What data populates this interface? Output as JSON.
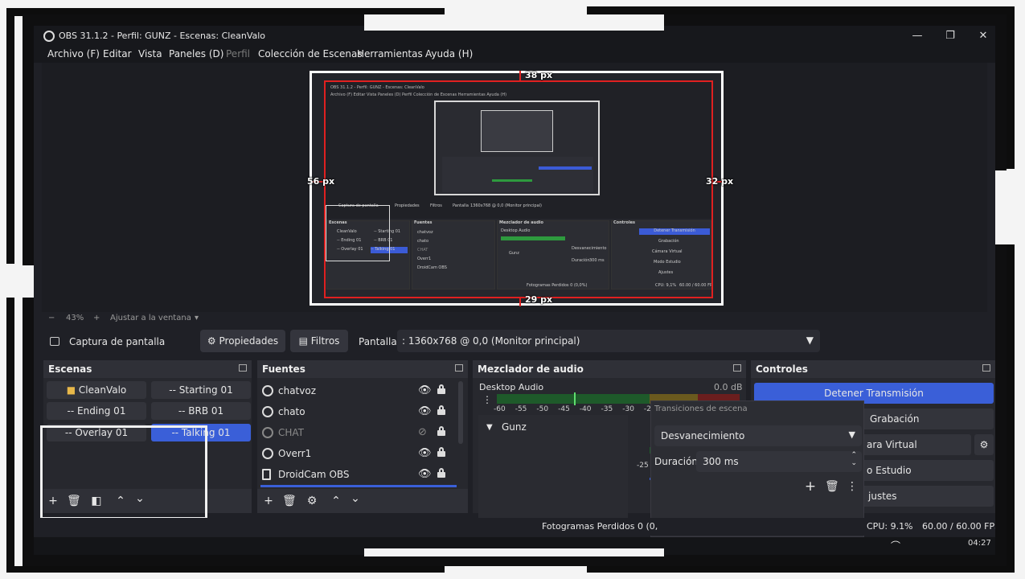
{
  "window": {
    "title": "OBS 31.1.2 - Perfil: GUNZ - Escenas: CleanValo",
    "minimize_icon": "minimize-icon",
    "maximize_icon": "restore-icon",
    "close_icon": "close-icon"
  },
  "menu": {
    "items": [
      "Archivo (F)",
      "Editar",
      "Vista",
      "Paneles (D)",
      "Perfil",
      "Colección de Escenas",
      "Herramientas",
      "Ayuda (H)"
    ]
  },
  "preview": {
    "label_top": "38 px",
    "label_left": "56 px",
    "label_right": "32 px",
    "label_bottom": "29 px",
    "mini_title": "OBS 31.1.2 - Perfil: GUNZ - Escenas: CleanValo",
    "mini_menu": "Archivo (F)   Editar   Vista   Paneles (D)   Perfil   Colección de Escenas   Herramientas   Ayuda (H)",
    "mini_source": "Captura de pantalla",
    "mini_props": "Propiedades",
    "mini_filters": "Filtros",
    "mini_screen": "Pantalla",
    "mini_monitor": "1360x768 @ 0,0 (Monitor principal)",
    "mini_scenes_title": "Escenas",
    "mini_sources_title": "Fuentes",
    "mini_mixer_title": "Mezclador de audio",
    "mini_controls_title": "Controles",
    "mini_scenes": [
      "CleanValo",
      "-- Starting 01",
      "-- Ending 01",
      "-- BRB 01",
      "-- Overlay 01",
      "-- Talking 01"
    ],
    "mini_sources": [
      "chatvoz",
      "chato",
      "CHAT",
      "Overr1",
      "DroidCam OBS"
    ],
    "mini_desktop_audio": "Desktop Audio",
    "mini_gunz": "Gunz",
    "mini_transition": "Desvanecimiento",
    "mini_duration_label": "Duración",
    "mini_duration": "300 ms",
    "mini_stop": "Detener Transmisión",
    "mini_record": "Grabación",
    "mini_virtual": "Cámara Virtual",
    "mini_studio": "Modo Estudio",
    "mini_settings": "Ajustes",
    "mini_dropped": "Fotogramas Perdidos 0 (0,0%)",
    "mini_cpu": "CPU: 9,1%",
    "mini_fps": "60.00 / 60.00 FPS"
  },
  "zoom": {
    "minus": "−",
    "value": "43%",
    "plus": "+",
    "fit_label": "Ajustar a la ventana",
    "dropdown_icon": "caret-down-icon"
  },
  "source_bar": {
    "source_name": "Captura de pantalla",
    "properties_label": "Propiedades",
    "filters_label": "Filtros",
    "screen_label": "Pantalla",
    "monitor_value": ": 1360x768 @ 0,0 (Monitor principal)"
  },
  "scenes": {
    "title": "Escenas",
    "items": [
      {
        "label": "CleanValo",
        "selected": false
      },
      {
        "label": "-- Starting 01",
        "selected": false
      },
      {
        "label": "-- Ending 01",
        "selected": false
      },
      {
        "label": "-- BRB 01",
        "selected": false
      },
      {
        "label": "-- Overlay 01",
        "selected": false
      },
      {
        "label": "-- Talking 01",
        "selected": true
      }
    ]
  },
  "sources": {
    "title": "Fuentes",
    "items": [
      {
        "label": "chatvoz",
        "visible": true
      },
      {
        "label": "chato",
        "visible": true
      },
      {
        "label": "CHAT",
        "visible": false
      },
      {
        "label": "Overr1",
        "visible": true
      },
      {
        "label": "DroidCam OBS",
        "visible": true
      }
    ]
  },
  "mixer": {
    "title": "Mezclador de audio",
    "channel": "Desktop Audio",
    "level": "0.0 dB",
    "ticks": [
      "-60",
      "-55",
      "-50",
      "-45",
      "-40",
      "-35",
      "-30",
      "-25"
    ],
    "tick_second": "-25",
    "dropdown_item": "Gunz"
  },
  "transitions": {
    "title": "Transiciones de escena",
    "type": "Desvanecimiento",
    "duration_label": "Duración",
    "duration_value": "300 ms"
  },
  "controls": {
    "title": "Controles",
    "stop_stream": "Detener Transmisión",
    "record": "Grabación",
    "virtual_cam": "ara Virtual",
    "studio": "o Estudio",
    "settings": "justes"
  },
  "status": {
    "dropped": "Fotogramas Perdidos 0 (0,",
    "cpu": "CPU: 9.1%",
    "fps": "60.00 / 60.00 FPS"
  },
  "taskbar": {
    "time": "04:27"
  },
  "colors": {
    "accent": "#3a5fd8",
    "guide": "#e02020",
    "meter_green": "#2e9a3e"
  }
}
